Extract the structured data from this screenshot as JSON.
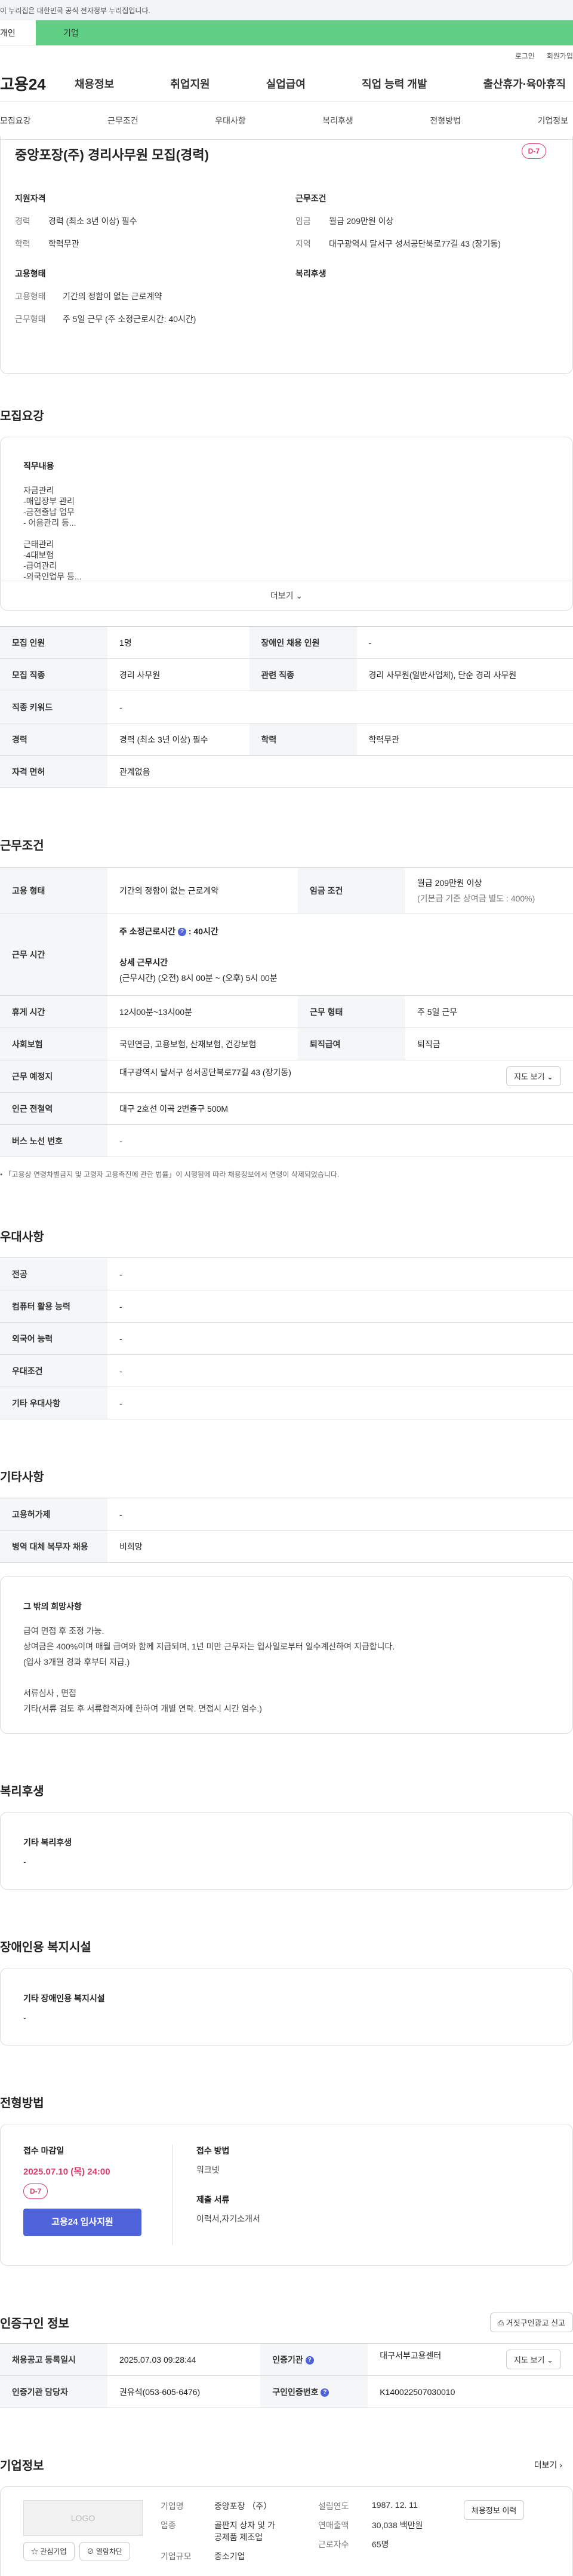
{
  "gov_banner": "이 누리집은 대한민국 공식 전자정부 누리집입니다.",
  "top_tabs": [
    "개인",
    "기업"
  ],
  "util": [
    "로그인",
    "회원가입"
  ],
  "logo": "고용24",
  "gnb": [
    "채용정보",
    "취업지원",
    "실업급여",
    "직업 능력 개발",
    "출산휴가·육아휴직"
  ],
  "subnav": [
    "모집요강",
    "근무조건",
    "우대사항",
    "복리후생",
    "전형방법",
    "기업정보"
  ],
  "summary": {
    "title": "중앙포장(주) 경리사무원 모집(경력)",
    "dday": "D-7",
    "qual_title": "지원자격",
    "qual": [
      {
        "k": "경력",
        "v": "경력 (최소 3년 이상) 필수"
      },
      {
        "k": "학력",
        "v": "학력무관"
      }
    ],
    "cond_title": "근무조건",
    "cond": [
      {
        "k": "임금",
        "v": "월급 209만원 이상"
      },
      {
        "k": "지역",
        "v": "대구광역시 달서구 성서공단북로77길 43 (장기동)"
      }
    ],
    "emp_title": "고용형태",
    "emp": [
      {
        "k": "고용형태",
        "v": "기간의 정함이 없는 근로계약"
      },
      {
        "k": "근무형태",
        "v": "주 5일 근무 (주 소정근로시간: 40시간)"
      }
    ],
    "welfare_title": "복리후생"
  },
  "recruit": {
    "title": "모집요강",
    "job_title": "직무내용",
    "job_lines": [
      "자금관리",
      "-매입장부 관리",
      "-금전출납 업무",
      "- 어음관리 등...",
      "",
      "근태관리",
      "-4대보험",
      "-급여관리",
      "-외국인업무 등..."
    ],
    "more": "더보기",
    "table": [
      [
        {
          "h": "모집 인원",
          "v": "1명"
        },
        {
          "h": "장애인 채용 인원",
          "v": "-"
        }
      ],
      [
        {
          "h": "모집 직종",
          "v": "경리 사무원"
        },
        {
          "h": "관련 직종",
          "v": "경리 사무원(일반사업체), 단순 경리 사무원"
        }
      ],
      [
        {
          "h": "직종 키워드",
          "v": "-"
        }
      ],
      [
        {
          "h": "경력",
          "v": "경력 (최소 3년 이상) 필수"
        },
        {
          "h": "학력",
          "v": "학력무관"
        }
      ],
      [
        {
          "h": "자격 면허",
          "v": "관계없음"
        }
      ]
    ]
  },
  "work": {
    "title": "근무조건",
    "emp_h": "고용 형태",
    "emp_v": "기간의 정함이 없는 근로계약",
    "wage_h": "임금 조건",
    "wage_v1": "월급 209만원 이상",
    "wage_v2": "(기본급 기준 상여금 별도 : 400%)",
    "hours_h": "근무 시간",
    "hours_week": "주 소정근로시간",
    "hours_week_val": "40시간",
    "hours_detail_title": "상세 근무시간",
    "hours_detail": "(근무시간) (오전) 8시 00분 ~ (오후) 5시 00분",
    "break_h": "휴게 시간",
    "break_v": "12시00분~13시00분",
    "form_h": "근무 형태",
    "form_v": "주 5일 근무",
    "ins_h": "사회보험",
    "ins_v": "국민연금, 고용보험, 산재보험, 건강보험",
    "sev_h": "퇴직급여",
    "sev_v": "퇴직금",
    "place_h": "근무 예정지",
    "place_v": "대구광역시 달서구 성서공단북로77길 43 (장기동)",
    "map_btn": "지도 보기",
    "subway_h": "인근 전철역",
    "subway_v": "대구 2호선 이곡 2번출구 500M",
    "bus_h": "버스 노선 번호",
    "bus_v": "-",
    "note": "「고용상 연령차별금지 및 고령자 고용촉진에 관한 법률」이 시행됨에 따라 채용정보에서 연령이 삭제되었습니다."
  },
  "pref": {
    "title": "우대사항",
    "rows": [
      {
        "h": "전공",
        "v": "-"
      },
      {
        "h": "컴퓨터 활용 능력",
        "v": "-"
      },
      {
        "h": "외국어 능력",
        "v": "-"
      },
      {
        "h": "우대조건",
        "v": "-"
      },
      {
        "h": "기타 우대사항",
        "v": "-"
      }
    ]
  },
  "etc": {
    "title": "기타사항",
    "rows": [
      {
        "h": "고용허가제",
        "v": "-"
      },
      {
        "h": "병역 대체 복무자 채용",
        "v": "비희망"
      }
    ],
    "box_title": "그 밖의 희망사항",
    "box_lines": [
      "급여 면접 후 조정 가능.",
      "상여금은 400%이며 매월 급여와 함께 지급되며, 1년 미만 근무자는 입사일로부터 일수계산하여 지급합니다.",
      "(입사 3개월 경과 후부터 지급.)",
      "",
      "서류심사 , 면접",
      "기타(서류 검토 후 서류합격자에 한하여 개별 연락.  면접시 시간 엄수.)"
    ]
  },
  "welfare": {
    "title": "복리후생",
    "sub": "기타 복리후생",
    "val": "-"
  },
  "disab": {
    "title": "장애인용 복지시설",
    "sub": "기타 장애인용 복지시설",
    "val": "-"
  },
  "screen": {
    "title": "전형방법",
    "deadline_label": "접수 마감일",
    "deadline": "2025.07.10 (목) 24:00",
    "dday": "D-7",
    "apply": "고용24 입사지원",
    "method_label": "접수 방법",
    "method": "워크넷",
    "docs_label": "제출 서류",
    "docs": "이력서,자기소개서"
  },
  "cert": {
    "title": "인증구인 정보",
    "report_btn": "거짓구인광고 신고",
    "reg_h": "채용공고 등록일시",
    "reg_v": "2025.07.03 09:28:44",
    "org_h": "인증기관",
    "org_v": "대구서부고용센터",
    "map_btn": "지도 보기",
    "mgr_h": "인증기관 담당자",
    "mgr_v": "권유석(053-605-6476)",
    "num_h": "구인인증번호",
    "num_v": "K140022507030010"
  },
  "company": {
    "title": "기업정보",
    "more": "더보기",
    "logo": "LOGO",
    "interest": "관심기업",
    "block": "열람차단",
    "name_h": "기업명",
    "name_v": "중앙포장 （주）",
    "ind_h": "업종",
    "ind_v1": "골판지 상자 및 가",
    "ind_v2": "공제품 제조업",
    "size_h": "기업규모",
    "size_v": "중소기업",
    "est_h": "설립연도",
    "est_v": "1987. 12. 11",
    "sales_h": "연매출액",
    "sales_v": "30,038 백만원",
    "staff_h": "근로자수",
    "staff_v": "65명",
    "jobs_btn": "채용정보 이력"
  }
}
